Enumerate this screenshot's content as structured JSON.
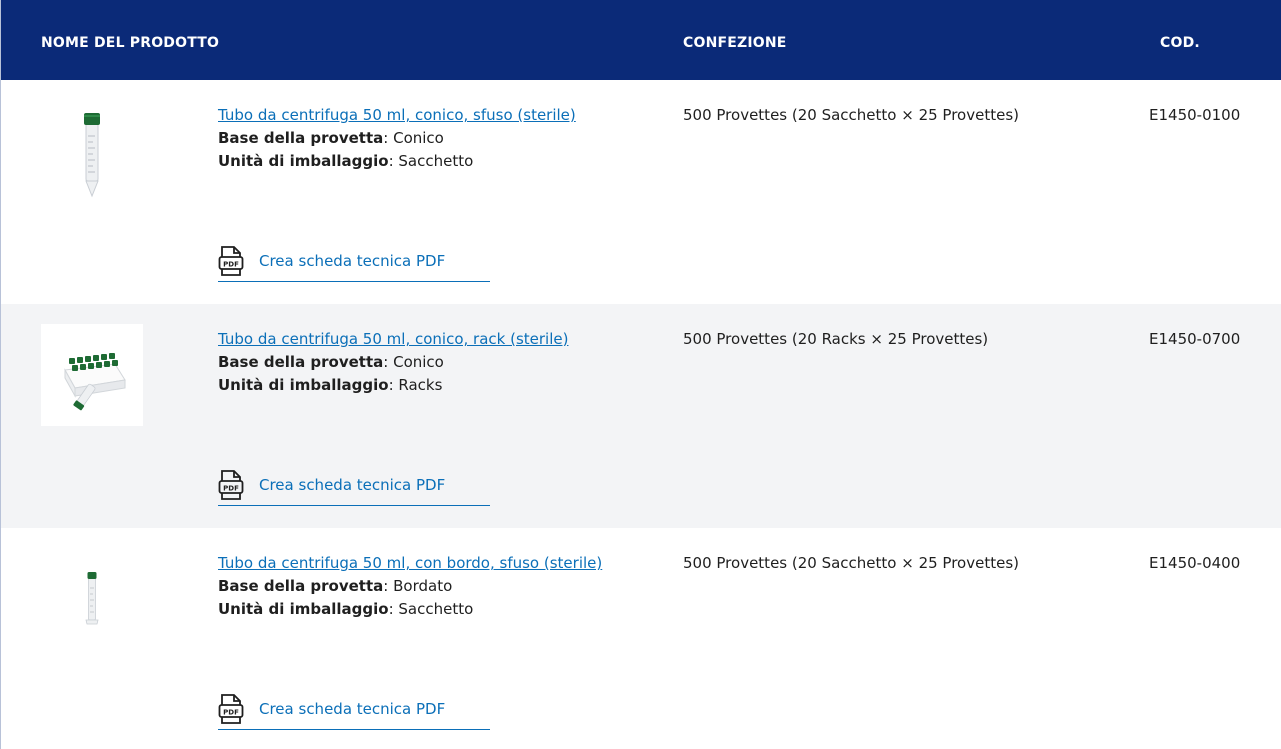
{
  "table": {
    "headers": {
      "name": "NOME DEL PRODOTTO",
      "package": "CONFEZIONE",
      "code": "COD."
    },
    "rows": [
      {
        "link": "Tubo da centrifuga 50 ml, conico, sfuso (sterile)",
        "base_label": "Base della provetta",
        "base_value": ": Conico",
        "unit_label": "Unità di imballaggio",
        "unit_value": ": Sacchetto",
        "pdf_label": "Crea scheda tecnica PDF",
        "package": "500 Provettes (20 Sacchetto × 25 Provettes)",
        "code": "E1450-0100"
      },
      {
        "link": "Tubo da centrifuga 50 ml, conico, rack (sterile)",
        "base_label": "Base della provetta",
        "base_value": ": Conico",
        "unit_label": "Unità di imballaggio",
        "unit_value": ": Racks",
        "pdf_label": "Crea scheda tecnica PDF",
        "package": "500 Provettes (20 Racks × 25 Provettes)",
        "code": "E1450-0700"
      },
      {
        "link": "Tubo da centrifuga 50 ml, con bordo, sfuso (sterile)",
        "base_label": "Base della provetta",
        "base_value": ": Bordato",
        "unit_label": "Unità di imballaggio",
        "unit_value": ": Sacchetto",
        "pdf_label": "Crea scheda tecnica PDF",
        "package": "500 Provettes (20 Sacchetto × 25 Provettes)",
        "code": "E1450-0400"
      }
    ],
    "pdf_icon_text": "PDF"
  },
  "colors": {
    "header_bg": "#0b2a78",
    "link": "#0b6fb8",
    "alt_row": "#f3f4f6",
    "cap_green": "#1e6b34"
  }
}
